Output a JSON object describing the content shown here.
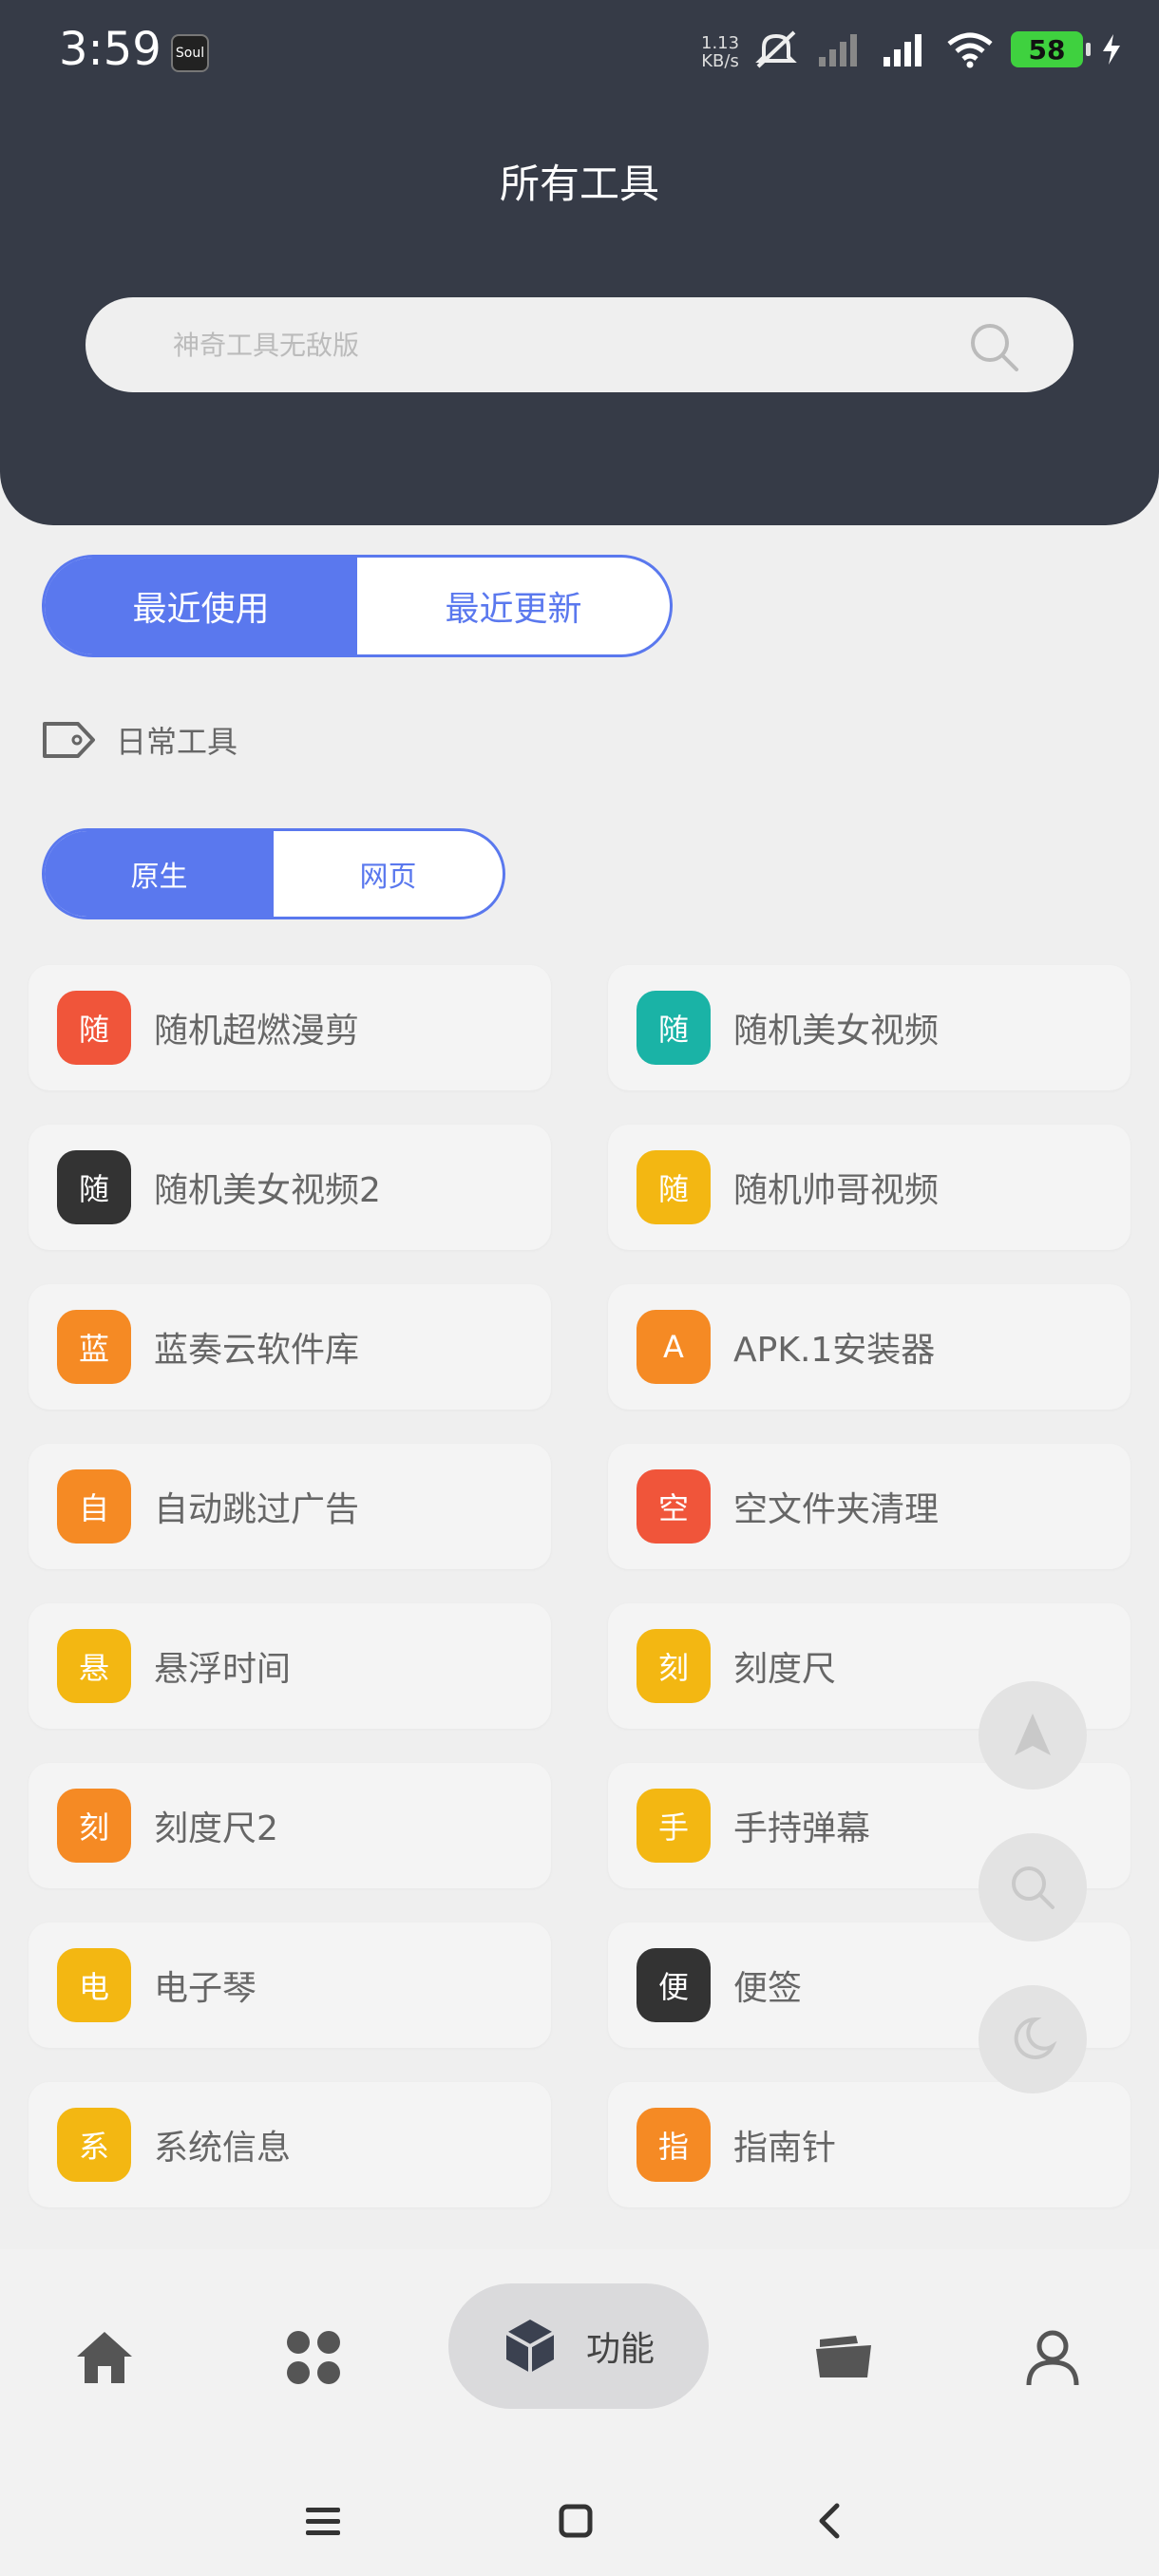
{
  "status": {
    "time": "3:59",
    "app_badge": "Soul",
    "net_speed_value": "1.13",
    "net_speed_unit": "KB/s",
    "battery": "58"
  },
  "header": {
    "title": "所有工具"
  },
  "search": {
    "placeholder": "神奇工具无敌版"
  },
  "tabs": [
    {
      "label": "最近使用",
      "active": true
    },
    {
      "label": "最近更新",
      "active": false
    }
  ],
  "section": {
    "label": "日常工具"
  },
  "subtabs": [
    {
      "label": "原生",
      "active": true
    },
    {
      "label": "网页",
      "active": false
    }
  ],
  "tools": [
    {
      "icon_text": "随",
      "name": "随机超燃漫剪",
      "color": "#f0553a"
    },
    {
      "icon_text": "随",
      "name": "随机美女视频",
      "color": "#1ab3a6"
    },
    {
      "icon_text": "随",
      "name": "随机美女视频2",
      "color": "#333333"
    },
    {
      "icon_text": "随",
      "name": "随机帅哥视频",
      "color": "#f3b712"
    },
    {
      "icon_text": "蓝",
      "name": "蓝奏云软件库",
      "color": "#f58a24"
    },
    {
      "icon_text": "A",
      "name": "APK.1安装器",
      "color": "#f58a24"
    },
    {
      "icon_text": "自",
      "name": "自动跳过广告",
      "color": "#f58a24"
    },
    {
      "icon_text": "空",
      "name": "空文件夹清理",
      "color": "#f0553a"
    },
    {
      "icon_text": "悬",
      "name": "悬浮时间",
      "color": "#f3b712"
    },
    {
      "icon_text": "刻",
      "name": "刻度尺",
      "color": "#f3b712"
    },
    {
      "icon_text": "刻",
      "name": "刻度尺2",
      "color": "#f58a24"
    },
    {
      "icon_text": "手",
      "name": "手持弹幕",
      "color": "#f3b712"
    },
    {
      "icon_text": "电",
      "name": "电子琴",
      "color": "#f3b712"
    },
    {
      "icon_text": "便",
      "name": "便签",
      "color": "#333333"
    },
    {
      "icon_text": "系",
      "name": "系统信息",
      "color": "#f3b712"
    },
    {
      "icon_text": "指",
      "name": "指南针",
      "color": "#f58a24"
    }
  ],
  "bottom_nav": {
    "active_label": "功能"
  }
}
